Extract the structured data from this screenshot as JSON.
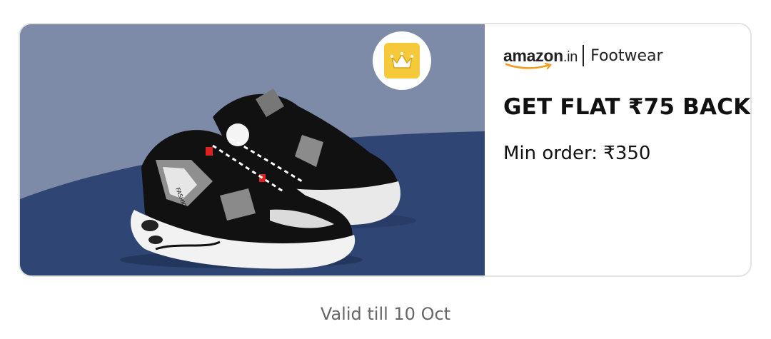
{
  "offer": {
    "brand": "amazon",
    "brand_tld": ".in",
    "category": "Footwear",
    "headline": "GET FLAT ₹75 BACK",
    "min_order": "Min order: ₹350",
    "validity": "Valid till 10 Oct"
  },
  "image": {
    "product": "black and white sports sneakers",
    "shoe_brand_text": "FASHION",
    "badge_icon": "crown-icon"
  },
  "colors": {
    "hero_bg": "#7d8aa8",
    "hero_floor": "#2f4573",
    "badge_tile": "#f5c93a",
    "amazon_smile": "#f29b1c",
    "text": "#111111",
    "muted": "#666666"
  }
}
